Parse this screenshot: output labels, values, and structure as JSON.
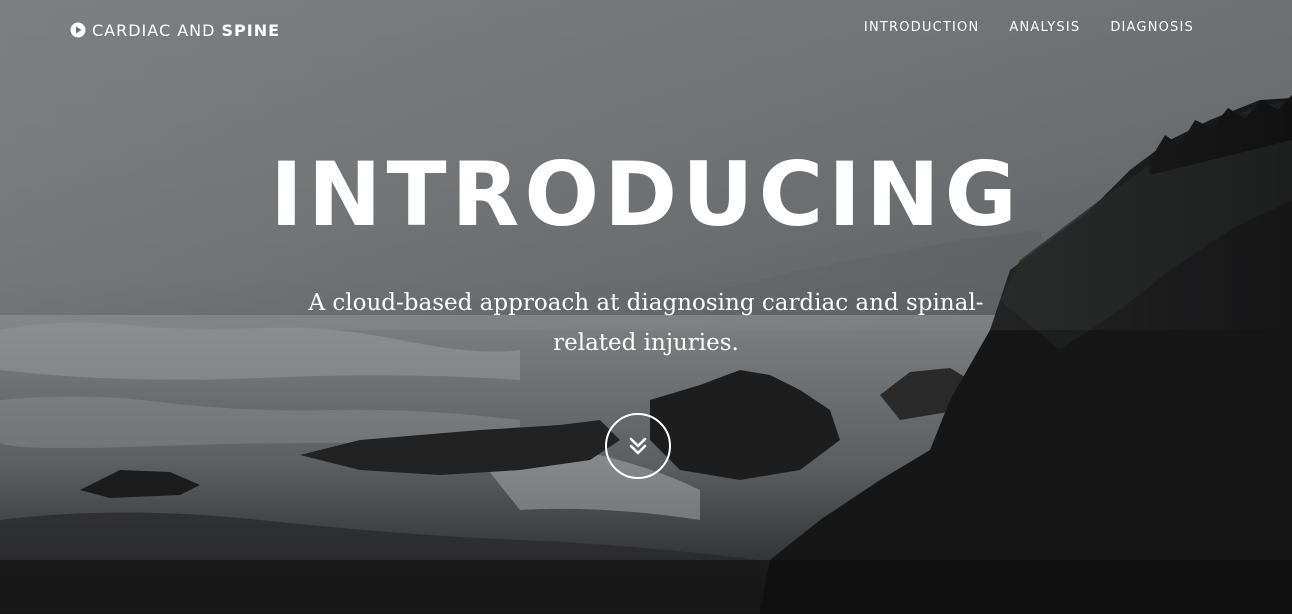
{
  "nav": {
    "brand": {
      "icon": "play-circle-icon",
      "light_text": "CARDIAC AND ",
      "bold_text": "SPINE"
    },
    "links": [
      "INTRODUCTION",
      "ANALYSIS",
      "DIAGNOSIS"
    ]
  },
  "hero": {
    "headline": "INTRODUCING",
    "subtitle": "A cloud-based approach at diagnosing cardiac and spinal-related injuries.",
    "scroll_icon": "double-chevron-down-icon",
    "background": "grayscale-ocean-coastline-photo"
  },
  "colors": {
    "text": "#ffffff",
    "sky": "#6f7274",
    "rock": "#151516"
  }
}
